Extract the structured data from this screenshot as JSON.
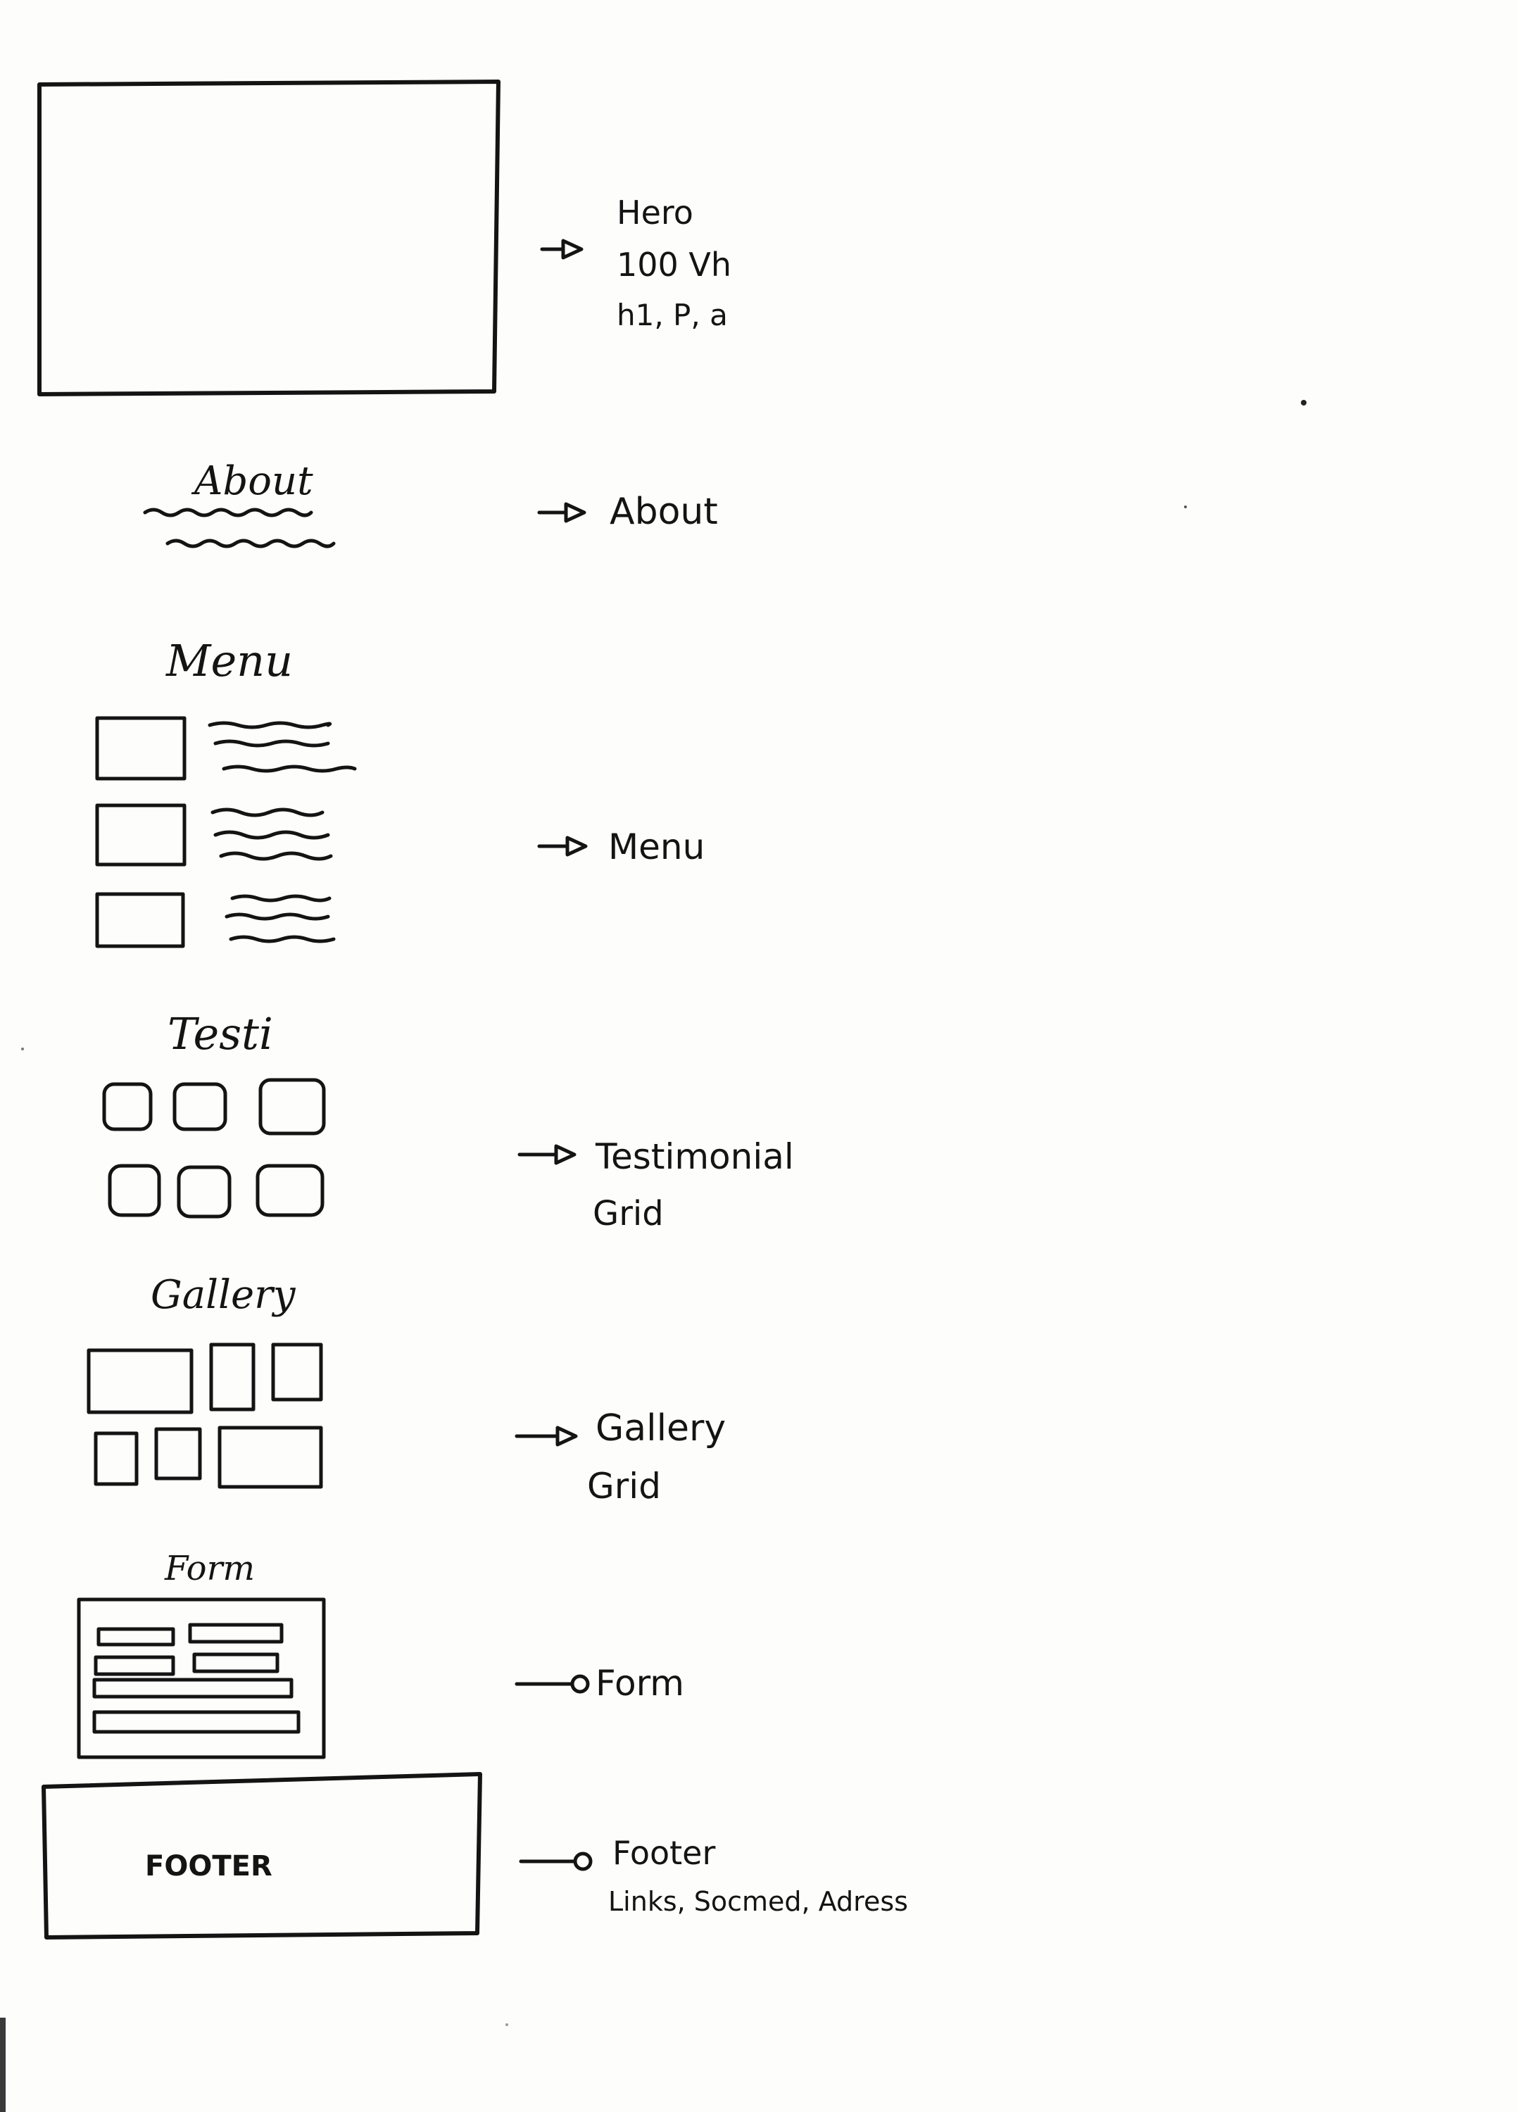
{
  "sketch_titles": {
    "about": "About",
    "menu": "Menu",
    "testimonial": "Testi",
    "gallery": "Gallery",
    "form": "Form",
    "footer": "FOOTER"
  },
  "annotations": {
    "hero": {
      "line1": "Hero",
      "line2": "100 Vh",
      "line3": "h1, P, a"
    },
    "about": {
      "line1": "About"
    },
    "menu": {
      "line1": "Menu"
    },
    "testimonial": {
      "line1": "Testimonial",
      "line2": "Grid"
    },
    "gallery": {
      "line1": "Gallery",
      "line2": "Grid"
    },
    "form": {
      "line1": "Form"
    },
    "footer": {
      "line1": "Footer",
      "line2": "Links, Socmed, Adress"
    }
  }
}
